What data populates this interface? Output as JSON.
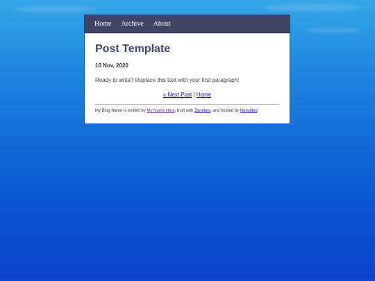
{
  "nav": {
    "items": [
      "Home",
      "Archive",
      "About"
    ]
  },
  "post": {
    "title": "Post Template",
    "date": "10 Nov, 2020",
    "paragraph": "Ready to write? Replace this text with your first paragraph!"
  },
  "pagination": {
    "next_label": "« Next Post",
    "separator": " | ",
    "home_label": "Home"
  },
  "footer": {
    "prefix": "My Blog Name is written by ",
    "author_link": "My Name Here",
    "mid1": ", built with ",
    "builder_link": "Zonelets",
    "mid2": ", and hosted by ",
    "host_link": "Neocities",
    "suffix": "!"
  }
}
